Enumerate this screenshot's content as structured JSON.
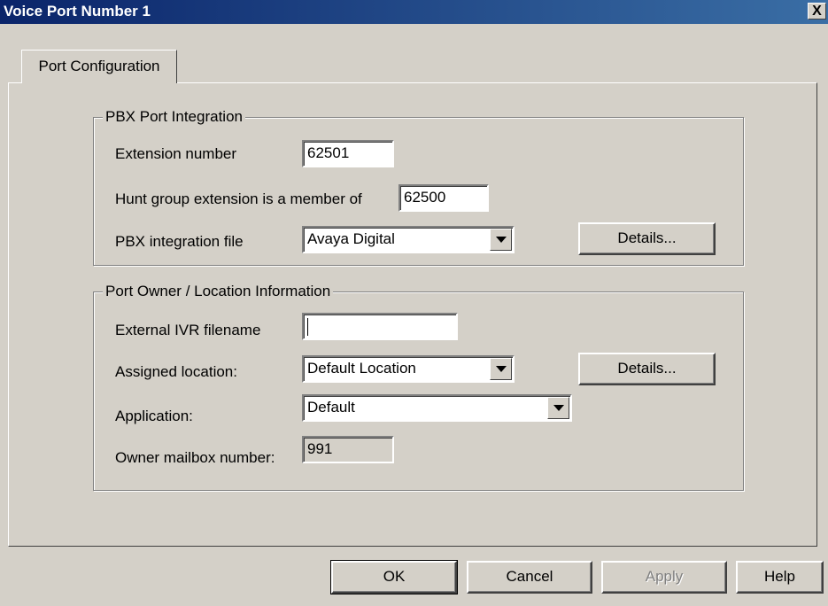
{
  "window": {
    "title": "Voice Port Number 1",
    "close_label": "X"
  },
  "tabs": [
    {
      "label": "Port Configuration",
      "active": true
    }
  ],
  "pbx_group": {
    "title": "PBX Port Integration",
    "extension_label": "Extension number",
    "extension_value": "62501",
    "hunt_label": "Hunt group extension is a member of",
    "hunt_value": "62500",
    "integration_label": "PBX integration file",
    "integration_value": "Avaya Digital",
    "details_label": "Details..."
  },
  "owner_group": {
    "title": "Port Owner / Location Information",
    "ivr_label": "External IVR filename",
    "ivr_value": "",
    "location_label": "Assigned location:",
    "location_value": "Default Location",
    "details_label": "Details...",
    "application_label": "Application:",
    "application_value": "Default",
    "mailbox_label": "Owner mailbox number:",
    "mailbox_value": "991"
  },
  "buttons": {
    "ok": "OK",
    "cancel": "Cancel",
    "apply": "Apply",
    "help": "Help"
  },
  "colors": {
    "face": "#d4d0c8",
    "title_start": "#0a246a",
    "title_end": "#3a6ea5",
    "disabled_text": "#808080"
  }
}
